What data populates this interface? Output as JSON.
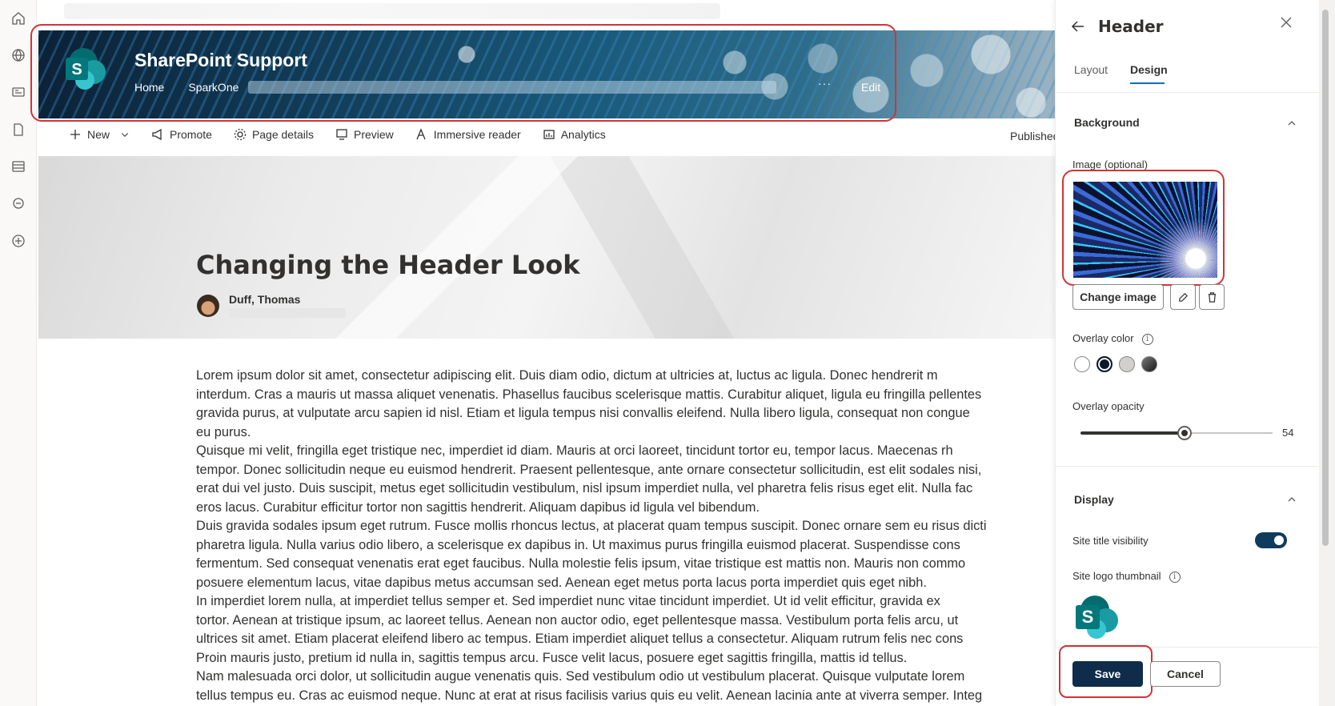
{
  "site_header": {
    "title": "SharePoint Support",
    "nav": [
      "Home",
      "SparkOne"
    ],
    "more": "···",
    "edit": "Edit"
  },
  "command_bar": {
    "items": [
      "New",
      "Promote",
      "Page details",
      "Preview",
      "Immersive reader",
      "Analytics"
    ],
    "status": "Published"
  },
  "page": {
    "title": "Changing the Header Look",
    "author": "Duff, Thomas",
    "body_lines": [
      "Lorem ipsum dolor sit amet, consectetur adipiscing elit. Duis diam odio, dictum at ultricies at, luctus ac ligula. Donec hendrerit m",
      "interdum. Cras a mauris ut massa aliquet venenatis. Phasellus faucibus scelerisque mattis. Curabitur aliquet, ligula eu fringilla pellentes",
      "gravida purus, at vulputate arcu sapien id nisl. Etiam et ligula tempus nisi convallis eleifend. Nulla libero ligula, consequat non congue",
      "eu purus.",
      "Quisque mi velit, fringilla eget tristique nec, imperdiet id diam. Mauris at orci laoreet, tincidunt tortor eu, tempor lacus. Maecenas rh",
      "tempor. Donec sollicitudin neque eu euismod hendrerit. Praesent pellentesque, ante ornare consectetur sollicitudin, est elit sodales nisi,",
      "erat dui vel justo. Duis suscipit, metus eget sollicitudin vestibulum, nisl ipsum imperdiet nulla, vel pharetra felis risus eget elit. Nulla fac",
      "eros lacus. Curabitur efficitur tortor non sagittis hendrerit. Aliquam dapibus id ligula vel bibendum.",
      "Duis gravida sodales ipsum eget rutrum. Fusce mollis rhoncus lectus, at placerat quam tempus suscipit. Donec ornare sem eu risus dicti",
      "pharetra ligula. Nulla varius odio libero, a scelerisque ex dapibus in. Ut maximus purus fringilla euismod placerat. Suspendisse cons",
      "fermentum. Sed consequat venenatis erat eget faucibus. Nulla molestie felis ipsum, vitae tristique est mattis non. Mauris non commo",
      "posuere elementum lacus, vitae dapibus metus accumsan sed. Aenean eget metus porta lacus porta imperdiet quis eget nibh.",
      "In imperdiet lorem nulla, at imperdiet tellus semper et. Sed imperdiet nunc vitae tincidunt imperdiet. Ut id velit efficitur, gravida ex",
      "tortor. Aenean at tristique ipsum, ac laoreet tellus. Aenean non auctor odio, eget pellentesque massa. Vestibulum porta felis arcu, ut",
      "ultrices sit amet. Etiam placerat eleifend libero ac tempus. Etiam imperdiet aliquet tellus a consectetur. Aliquam rutrum felis nec cons",
      "Proin mauris justo, pretium id nulla in, sagittis tempus arcu. Fusce velit lacus, posuere eget sagittis fringilla, mattis id tellus.",
      "Nam malesuada orci dolor, ut sollicitudin augue venenatis quis. Sed vestibulum odio ut vestibulum placerat. Quisque vulputate lorem",
      "tellus tempus eu. Cras ac euismod neque. Nunc at erat at risus facilisis varius quis eu velit. Aenean lacinia ante at viverra semper. Integ"
    ]
  },
  "panel": {
    "title": "Header",
    "tabs": [
      "Layout",
      "Design"
    ],
    "active_tab": "Design",
    "background": {
      "heading": "Background",
      "image_label": "Image (optional)",
      "change_image": "Change image",
      "overlay_color_label": "Overlay color",
      "overlay_colors": [
        "#ffffff",
        "#0b1a2b",
        "#d2d0ce",
        "#323130"
      ],
      "selected_overlay_color": 1,
      "overlay_opacity_label": "Overlay opacity",
      "overlay_opacity": 54
    },
    "display": {
      "heading": "Display",
      "site_title_visibility_label": "Site title visibility",
      "site_title_visibility": true,
      "site_logo_thumbnail_label": "Site logo thumbnail"
    },
    "save": "Save",
    "cancel": "Cancel"
  },
  "colors": {
    "accent": "#0f6cbd",
    "primary_button": "#0f2d4a",
    "highlight_outline": "#d13438",
    "sharepoint_teal": "#038387"
  }
}
